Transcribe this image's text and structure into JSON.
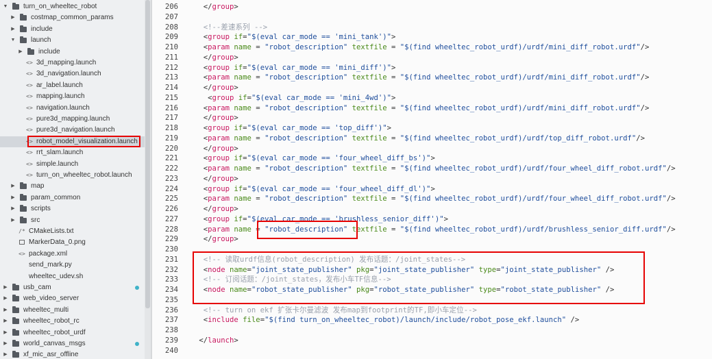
{
  "colors": {
    "sidebar_bg": "#eef0f2",
    "editor_bg": "#fbfbfb",
    "tag": "#c9175f",
    "attribute": "#4a8a1a",
    "string": "#1f4e9c",
    "comment": "#9aa1ad",
    "highlight": "#e60000",
    "status_dot": "#3fb2c8"
  },
  "sidebar": {
    "items": [
      {
        "label": "turn_on_wheeltec_robot",
        "type": "folder",
        "depth": 0,
        "expanded": true
      },
      {
        "label": "costmap_common_params",
        "type": "folder",
        "depth": 1,
        "expanded": false
      },
      {
        "label": "include",
        "type": "folder",
        "depth": 1,
        "expanded": false
      },
      {
        "label": "launch",
        "type": "folder",
        "depth": 1,
        "expanded": true
      },
      {
        "label": "include",
        "type": "folder",
        "depth": 2,
        "expanded": false
      },
      {
        "label": "3d_mapping.launch",
        "type": "file",
        "icon": "<>",
        "depth": 2
      },
      {
        "label": "3d_navigation.launch",
        "type": "file",
        "icon": "<>",
        "depth": 2
      },
      {
        "label": "ar_label.launch",
        "type": "file",
        "icon": "<>",
        "depth": 2
      },
      {
        "label": "mapping.launch",
        "type": "file",
        "icon": "<>",
        "depth": 2
      },
      {
        "label": "navigation.launch",
        "type": "file",
        "icon": "<>",
        "depth": 2
      },
      {
        "label": "pure3d_mapping.launch",
        "type": "file",
        "icon": "<>",
        "depth": 2
      },
      {
        "label": "pure3d_navigation.launch",
        "type": "file",
        "icon": "<>",
        "depth": 2
      },
      {
        "label": "robot_model_visualization.launch",
        "type": "file",
        "icon": "<>",
        "depth": 2,
        "selected": true
      },
      {
        "label": "rrt_slam.launch",
        "type": "file",
        "icon": "<>",
        "depth": 2
      },
      {
        "label": "simple.launch",
        "type": "file",
        "icon": "<>",
        "depth": 2
      },
      {
        "label": "turn_on_wheeltec_robot.launch",
        "type": "file",
        "icon": "<>",
        "depth": 2
      },
      {
        "label": "map",
        "type": "folder",
        "depth": 1,
        "expanded": false
      },
      {
        "label": "param_common",
        "type": "folder",
        "depth": 1,
        "expanded": false
      },
      {
        "label": "scripts",
        "type": "folder",
        "depth": 1,
        "expanded": false
      },
      {
        "label": "src",
        "type": "folder",
        "depth": 1,
        "expanded": false
      },
      {
        "label": "CMakeLists.txt",
        "type": "file",
        "icon": "/*",
        "depth": 1
      },
      {
        "label": "MarkerData_0.png",
        "type": "file",
        "icon": "img",
        "depth": 1
      },
      {
        "label": "package.xml",
        "type": "file",
        "icon": "<>",
        "depth": 1
      },
      {
        "label": "send_mark.py",
        "type": "file",
        "icon": "",
        "depth": 1
      },
      {
        "label": "wheeltec_udev.sh",
        "type": "file",
        "icon": "",
        "depth": 1
      },
      {
        "label": "usb_cam",
        "type": "folder",
        "depth": 0,
        "expanded": false,
        "dot": true
      },
      {
        "label": "web_video_server",
        "type": "folder",
        "depth": 0,
        "expanded": false
      },
      {
        "label": "wheeltec_multi",
        "type": "folder",
        "depth": 0,
        "expanded": false
      },
      {
        "label": "wheeltec_robot_rc",
        "type": "folder",
        "depth": 0,
        "expanded": false
      },
      {
        "label": "wheeltec_robot_urdf",
        "type": "folder",
        "depth": 0,
        "expanded": false
      },
      {
        "label": "world_canvas_msgs",
        "type": "folder",
        "depth": 0,
        "expanded": false,
        "dot": true
      },
      {
        "label": "xf_mic_asr_offline",
        "type": "folder",
        "depth": 0,
        "expanded": false
      }
    ]
  },
  "editor": {
    "lines": [
      {
        "num": "206",
        "segs": [
          [
            "pun",
            "  </"
          ],
          [
            "tag",
            "group"
          ],
          [
            "pun",
            ">"
          ]
        ]
      },
      {
        "num": "207",
        "segs": []
      },
      {
        "num": "208",
        "segs": [
          [
            "com",
            "  <!--差速系列 -->"
          ]
        ]
      },
      {
        "num": "209",
        "segs": [
          [
            "pun",
            "  <"
          ],
          [
            "tag",
            "group"
          ],
          [
            "attr",
            " if"
          ],
          [
            "pun",
            "="
          ],
          [
            "str",
            "\"$(eval car_mode == 'mini_tank')\""
          ],
          [
            "pun",
            ">"
          ]
        ]
      },
      {
        "num": "210",
        "segs": [
          [
            "pun",
            "  <"
          ],
          [
            "tag",
            "param"
          ],
          [
            "attr",
            " name"
          ],
          [
            "pun",
            " = "
          ],
          [
            "str",
            "\"robot_description\""
          ],
          [
            "attr",
            " textfile"
          ],
          [
            "pun",
            " = "
          ],
          [
            "str",
            "\"$(find wheeltec_robot_urdf)/urdf/mini_diff_robot.urdf\""
          ],
          [
            "pun",
            "/>"
          ]
        ]
      },
      {
        "num": "211",
        "segs": [
          [
            "pun",
            "  </"
          ],
          [
            "tag",
            "group"
          ],
          [
            "pun",
            ">"
          ]
        ]
      },
      {
        "num": "212",
        "segs": [
          [
            "pun",
            "  <"
          ],
          [
            "tag",
            "group"
          ],
          [
            "attr",
            " if"
          ],
          [
            "pun",
            "="
          ],
          [
            "str",
            "\"$(eval car_mode == 'mini_diff')\""
          ],
          [
            "pun",
            ">"
          ]
        ]
      },
      {
        "num": "213",
        "segs": [
          [
            "pun",
            "  <"
          ],
          [
            "tag",
            "param"
          ],
          [
            "attr",
            " name"
          ],
          [
            "pun",
            " = "
          ],
          [
            "str",
            "\"robot_description\""
          ],
          [
            "attr",
            " textfile"
          ],
          [
            "pun",
            " = "
          ],
          [
            "str",
            "\"$(find wheeltec_robot_urdf)/urdf/mini_diff_robot.urdf\""
          ],
          [
            "pun",
            "/>"
          ]
        ]
      },
      {
        "num": "214",
        "segs": [
          [
            "pun",
            "  </"
          ],
          [
            "tag",
            "group"
          ],
          [
            "pun",
            ">"
          ]
        ]
      },
      {
        "num": "215",
        "segs": [
          [
            "pun",
            "   <"
          ],
          [
            "tag",
            "group"
          ],
          [
            "attr",
            " if"
          ],
          [
            "pun",
            "="
          ],
          [
            "str",
            "\"$(eval car_mode == 'mini_4wd')\""
          ],
          [
            "pun",
            ">"
          ]
        ]
      },
      {
        "num": "216",
        "segs": [
          [
            "pun",
            "  <"
          ],
          [
            "tag",
            "param"
          ],
          [
            "attr",
            " name"
          ],
          [
            "pun",
            " = "
          ],
          [
            "str",
            "\"robot_description\""
          ],
          [
            "attr",
            " textfile"
          ],
          [
            "pun",
            " = "
          ],
          [
            "str",
            "\"$(find wheeltec_robot_urdf)/urdf/mini_diff_robot.urdf\""
          ],
          [
            "pun",
            "/>"
          ]
        ]
      },
      {
        "num": "217",
        "segs": [
          [
            "pun",
            "  </"
          ],
          [
            "tag",
            "group"
          ],
          [
            "pun",
            ">"
          ]
        ]
      },
      {
        "num": "218",
        "segs": [
          [
            "pun",
            "  <"
          ],
          [
            "tag",
            "group"
          ],
          [
            "attr",
            " if"
          ],
          [
            "pun",
            "="
          ],
          [
            "str",
            "\"$(eval car_mode == 'top_diff')\""
          ],
          [
            "pun",
            ">"
          ]
        ]
      },
      {
        "num": "219",
        "segs": [
          [
            "pun",
            "  <"
          ],
          [
            "tag",
            "param"
          ],
          [
            "attr",
            " name"
          ],
          [
            "pun",
            " = "
          ],
          [
            "str",
            "\"robot_description\""
          ],
          [
            "attr",
            " textfile"
          ],
          [
            "pun",
            " = "
          ],
          [
            "str",
            "\"$(find wheeltec_robot_urdf)/urdf/top_diff_robot.urdf\""
          ],
          [
            "pun",
            "/>"
          ]
        ]
      },
      {
        "num": "220",
        "segs": [
          [
            "pun",
            "  </"
          ],
          [
            "tag",
            "group"
          ],
          [
            "pun",
            ">"
          ]
        ]
      },
      {
        "num": "221",
        "segs": [
          [
            "pun",
            "  <"
          ],
          [
            "tag",
            "group"
          ],
          [
            "attr",
            " if"
          ],
          [
            "pun",
            "="
          ],
          [
            "str",
            "\"$(eval car_mode == 'four_wheel_diff_bs')\""
          ],
          [
            "pun",
            ">"
          ]
        ]
      },
      {
        "num": "222",
        "segs": [
          [
            "pun",
            "  <"
          ],
          [
            "tag",
            "param"
          ],
          [
            "attr",
            " name"
          ],
          [
            "pun",
            " = "
          ],
          [
            "str",
            "\"robot_description\""
          ],
          [
            "attr",
            " textfile"
          ],
          [
            "pun",
            " = "
          ],
          [
            "str",
            "\"$(find wheeltec_robot_urdf)/urdf/four_wheel_diff_robot.urdf\""
          ],
          [
            "pun",
            "/>"
          ]
        ]
      },
      {
        "num": "223",
        "segs": [
          [
            "pun",
            "  </"
          ],
          [
            "tag",
            "group"
          ],
          [
            "pun",
            ">"
          ]
        ]
      },
      {
        "num": "224",
        "segs": [
          [
            "pun",
            "  <"
          ],
          [
            "tag",
            "group"
          ],
          [
            "attr",
            " if"
          ],
          [
            "pun",
            "="
          ],
          [
            "str",
            "\"$(eval car_mode == 'four_wheel_diff_dl')\""
          ],
          [
            "pun",
            ">"
          ]
        ]
      },
      {
        "num": "225",
        "segs": [
          [
            "pun",
            "  <"
          ],
          [
            "tag",
            "param"
          ],
          [
            "attr",
            " name"
          ],
          [
            "pun",
            " = "
          ],
          [
            "str",
            "\"robot_description\""
          ],
          [
            "attr",
            " textfile"
          ],
          [
            "pun",
            " = "
          ],
          [
            "str",
            "\"$(find wheeltec_robot_urdf)/urdf/four_wheel_diff_robot.urdf\""
          ],
          [
            "pun",
            "/>"
          ]
        ]
      },
      {
        "num": "226",
        "segs": [
          [
            "pun",
            "  </"
          ],
          [
            "tag",
            "group"
          ],
          [
            "pun",
            ">"
          ]
        ]
      },
      {
        "num": "227",
        "segs": [
          [
            "pun",
            "  <"
          ],
          [
            "tag",
            "group"
          ],
          [
            "attr",
            " if"
          ],
          [
            "pun",
            "="
          ],
          [
            "str",
            "\"$(eval car_mode == 'brushless_senior_diff')\""
          ],
          [
            "pun",
            ">"
          ]
        ]
      },
      {
        "num": "228",
        "segs": [
          [
            "pun",
            "  <"
          ],
          [
            "tag",
            "param"
          ],
          [
            "attr",
            " name"
          ],
          [
            "pun",
            " = "
          ],
          [
            "str",
            "\"robot_description\""
          ],
          [
            "attr",
            " textfile"
          ],
          [
            "pun",
            " = "
          ],
          [
            "str",
            "\"$(find wheeltec_robot_urdf)/urdf/brushless_senior_diff.urdf\""
          ],
          [
            "pun",
            "/>"
          ]
        ]
      },
      {
        "num": "229",
        "segs": [
          [
            "pun",
            "  </"
          ],
          [
            "tag",
            "group"
          ],
          [
            "pun",
            ">"
          ]
        ]
      },
      {
        "num": "230",
        "segs": []
      },
      {
        "num": "231",
        "segs": [
          [
            "com",
            "  <!-- 读取urdf信息(robot_description) 发布话题：/joint_states-->"
          ]
        ]
      },
      {
        "num": "232",
        "segs": [
          [
            "pun",
            "  <"
          ],
          [
            "tag",
            "node"
          ],
          [
            "attr",
            " name"
          ],
          [
            "pun",
            "="
          ],
          [
            "str",
            "\"joint_state_publisher\""
          ],
          [
            "attr",
            " pkg"
          ],
          [
            "pun",
            "="
          ],
          [
            "str",
            "\"joint_state_publisher\""
          ],
          [
            "attr",
            " type"
          ],
          [
            "pun",
            "="
          ],
          [
            "str",
            "\"joint_state_publisher\""
          ],
          [
            "pun",
            " />"
          ]
        ]
      },
      {
        "num": "233",
        "segs": [
          [
            "com",
            "  <!-- 订阅话题：/joint_states，发布小车TF信息-->"
          ]
        ]
      },
      {
        "num": "234",
        "segs": [
          [
            "pun",
            "  <"
          ],
          [
            "tag",
            "node"
          ],
          [
            "attr",
            " name"
          ],
          [
            "pun",
            "="
          ],
          [
            "str",
            "\"robot_state_publisher\""
          ],
          [
            "attr",
            " pkg"
          ],
          [
            "pun",
            "="
          ],
          [
            "str",
            "\"robot_state_publisher\""
          ],
          [
            "attr",
            " type"
          ],
          [
            "pun",
            "="
          ],
          [
            "str",
            "\"robot_state_publisher\""
          ],
          [
            "pun",
            " />"
          ]
        ]
      },
      {
        "num": "235",
        "segs": []
      },
      {
        "num": "236",
        "segs": [
          [
            "com",
            "  <!-- turn on ekf 扩张卡尔曼滤波 发布map到footprint的TF,即小车定位-->"
          ]
        ]
      },
      {
        "num": "237",
        "segs": [
          [
            "pun",
            "  <"
          ],
          [
            "tag",
            "include"
          ],
          [
            "attr",
            " file"
          ],
          [
            "pun",
            "="
          ],
          [
            "str",
            "\"$(find turn_on_wheeltec_robot)/launch/include/robot_pose_ekf.launch\""
          ],
          [
            "pun",
            " />"
          ]
        ]
      },
      {
        "num": "238",
        "segs": []
      },
      {
        "num": "239",
        "segs": [
          [
            "pun",
            " </"
          ],
          [
            "tag",
            "launch"
          ],
          [
            "pun",
            ">"
          ]
        ]
      },
      {
        "num": "240",
        "segs": []
      }
    ]
  }
}
